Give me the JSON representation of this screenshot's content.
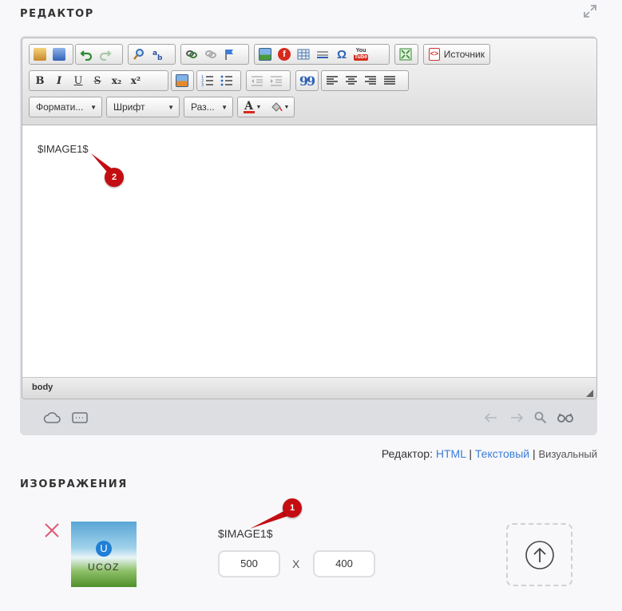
{
  "editor_section": {
    "title": "РЕДАКТОР",
    "toolbar": {
      "source_label": "Источник",
      "format_combo": "Формати...",
      "font_combo": "Шрифт",
      "size_combo": "Раз...",
      "bold": "B",
      "italic": "I",
      "underline": "U",
      "strike": "S",
      "subscript": "x₂",
      "superscript": "x²",
      "omega": "Ω",
      "youtube_top": "You",
      "youtube_bottom": "Tube",
      "blockquote": "99",
      "text_color_letter": "A"
    },
    "content_text": "$IMAGE1$",
    "element_path": "body",
    "badge_2": "2"
  },
  "editor_mode": {
    "label": "Редактор:",
    "html": "HTML",
    "separator": "|",
    "text": "Текстовый",
    "visual": "Визуальный"
  },
  "images_section": {
    "title": "ИЗОБРАЖЕНИЯ",
    "thumbnail_logo_letter": "U",
    "thumbnail_logo_text": "UCOZ",
    "image_code": "$IMAGE1$",
    "width_value": "500",
    "times_sign": "X",
    "height_value": "400",
    "badge_1": "1"
  },
  "colors": {
    "accent_link": "#3b7dd8",
    "badge": "#c40d12",
    "delete_x": "#e05a74"
  }
}
